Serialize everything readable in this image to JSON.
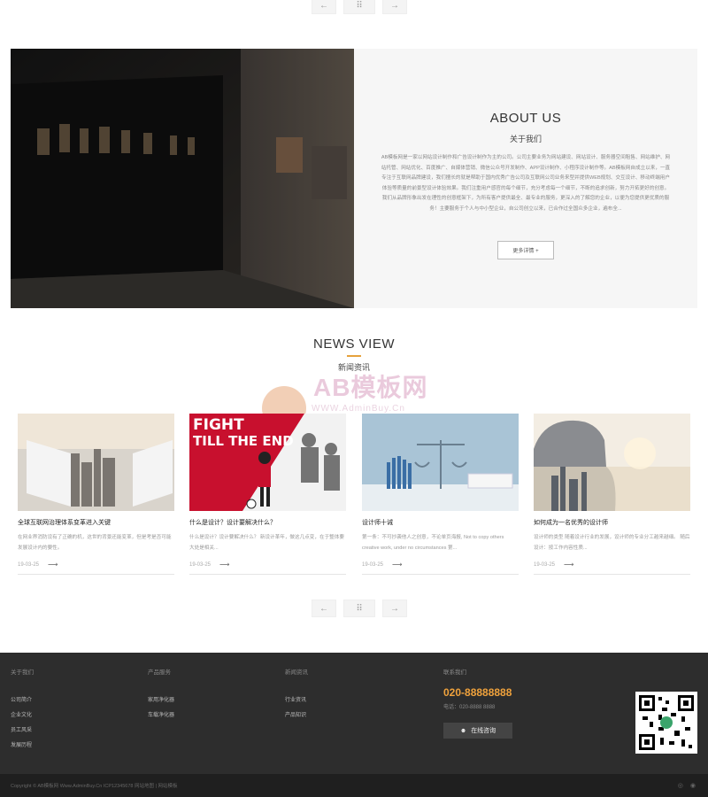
{
  "top_pager": {
    "prev": "←",
    "grid": "⠿",
    "next": "→"
  },
  "about": {
    "title": "ABOUT US",
    "subtitle": "关于我们",
    "text": "AB模板网是一家以网站设计制作和广告设计制作为主的公司。公司主要业务为网站建设、网站设计、服务器空间租售、网站维护、网站托管、网站优化、百度推广、自媒体营销、微信公众号开发制作、APP设计制作、小程序设计制作等。AB模板网自成立以来，一直专注于互联网品牌建设，我们擅长的就是帮助于国内优秀广告公司及互联网公司业务来型并提供WEB规划、交互设计、移动终端用户体验等质量的前景型设计体验效果。我们注重用户感官的每个细节，充分考虑每一个细节，不断的追求创新，努力开拓更好的创意。我们从品牌形象出发在理性的创意框架下，为所有客户提供最全、最专业的服务，更深入的了解您的企业，以便为您提供更优质的服务！主要服务于个人与中小型企业，自公司创立以来，已合作过全国众多企业，遍布全...",
    "more": "更多详情 +"
  },
  "news": {
    "title": "NEWS VIEW",
    "subtitle": "新闻资讯",
    "watermark_brand": "AB模板网",
    "watermark_url": "WWW.AdminBuy.Cn",
    "items": [
      {
        "title": "全球互联网治理体系变革进入关键",
        "desc": "在网业界消防设有了正确的机，这世的背景还能变革，但是考是否可能发展设计内的要性。",
        "date": "19-03-25"
      },
      {
        "title": "什么是设计？设计要解决什么？",
        "desc": "什么是设计？设计要解决什么？ 新设计革年，做这几点变，在于整体要大处是相关...",
        "date": "19-03-25"
      },
      {
        "title": "设计师十诫",
        "desc": "第一条：不可抄袭他人之创意，不论单页海报, Not to copy others creative work, under no circumstances 第...",
        "date": "19-03-25"
      },
      {
        "title": "如何成为一名优秀的设计师",
        "desc": "设计师的类型 随着设计行业的发展，设计师的专业分工越来越细。 随后设计：按工作内容性质...",
        "date": "19-03-25"
      }
    ]
  },
  "bottom_pager": {
    "prev": "←",
    "grid": "⠿",
    "next": "→"
  },
  "footer": {
    "col1": {
      "heading": "关于我们",
      "links": [
        "公司简介",
        "企业文化",
        "员工风采",
        "发展历程"
      ]
    },
    "col2": {
      "heading": "产品服务",
      "links": [
        "家用净化器",
        "车载净化器"
      ]
    },
    "col3": {
      "heading": "新闻资讯",
      "links": [
        "行业资讯",
        "产品知识"
      ]
    },
    "col4": {
      "heading": "联系我们",
      "phone": "020-88888888",
      "tel": "电话：020-8888 8888",
      "online": "在线咨询"
    },
    "copyright": "Copyright © AB模板网 Www.AdminBuy.Cn    ICP12345678    网站地图 | 网站模板",
    "icons": [
      "weibo-icon",
      "wechat-icon"
    ]
  },
  "colors": {
    "accent": "#f0a23c",
    "footer_bg": "#2d2d2d",
    "bottom_bg": "#1f1f1f"
  }
}
